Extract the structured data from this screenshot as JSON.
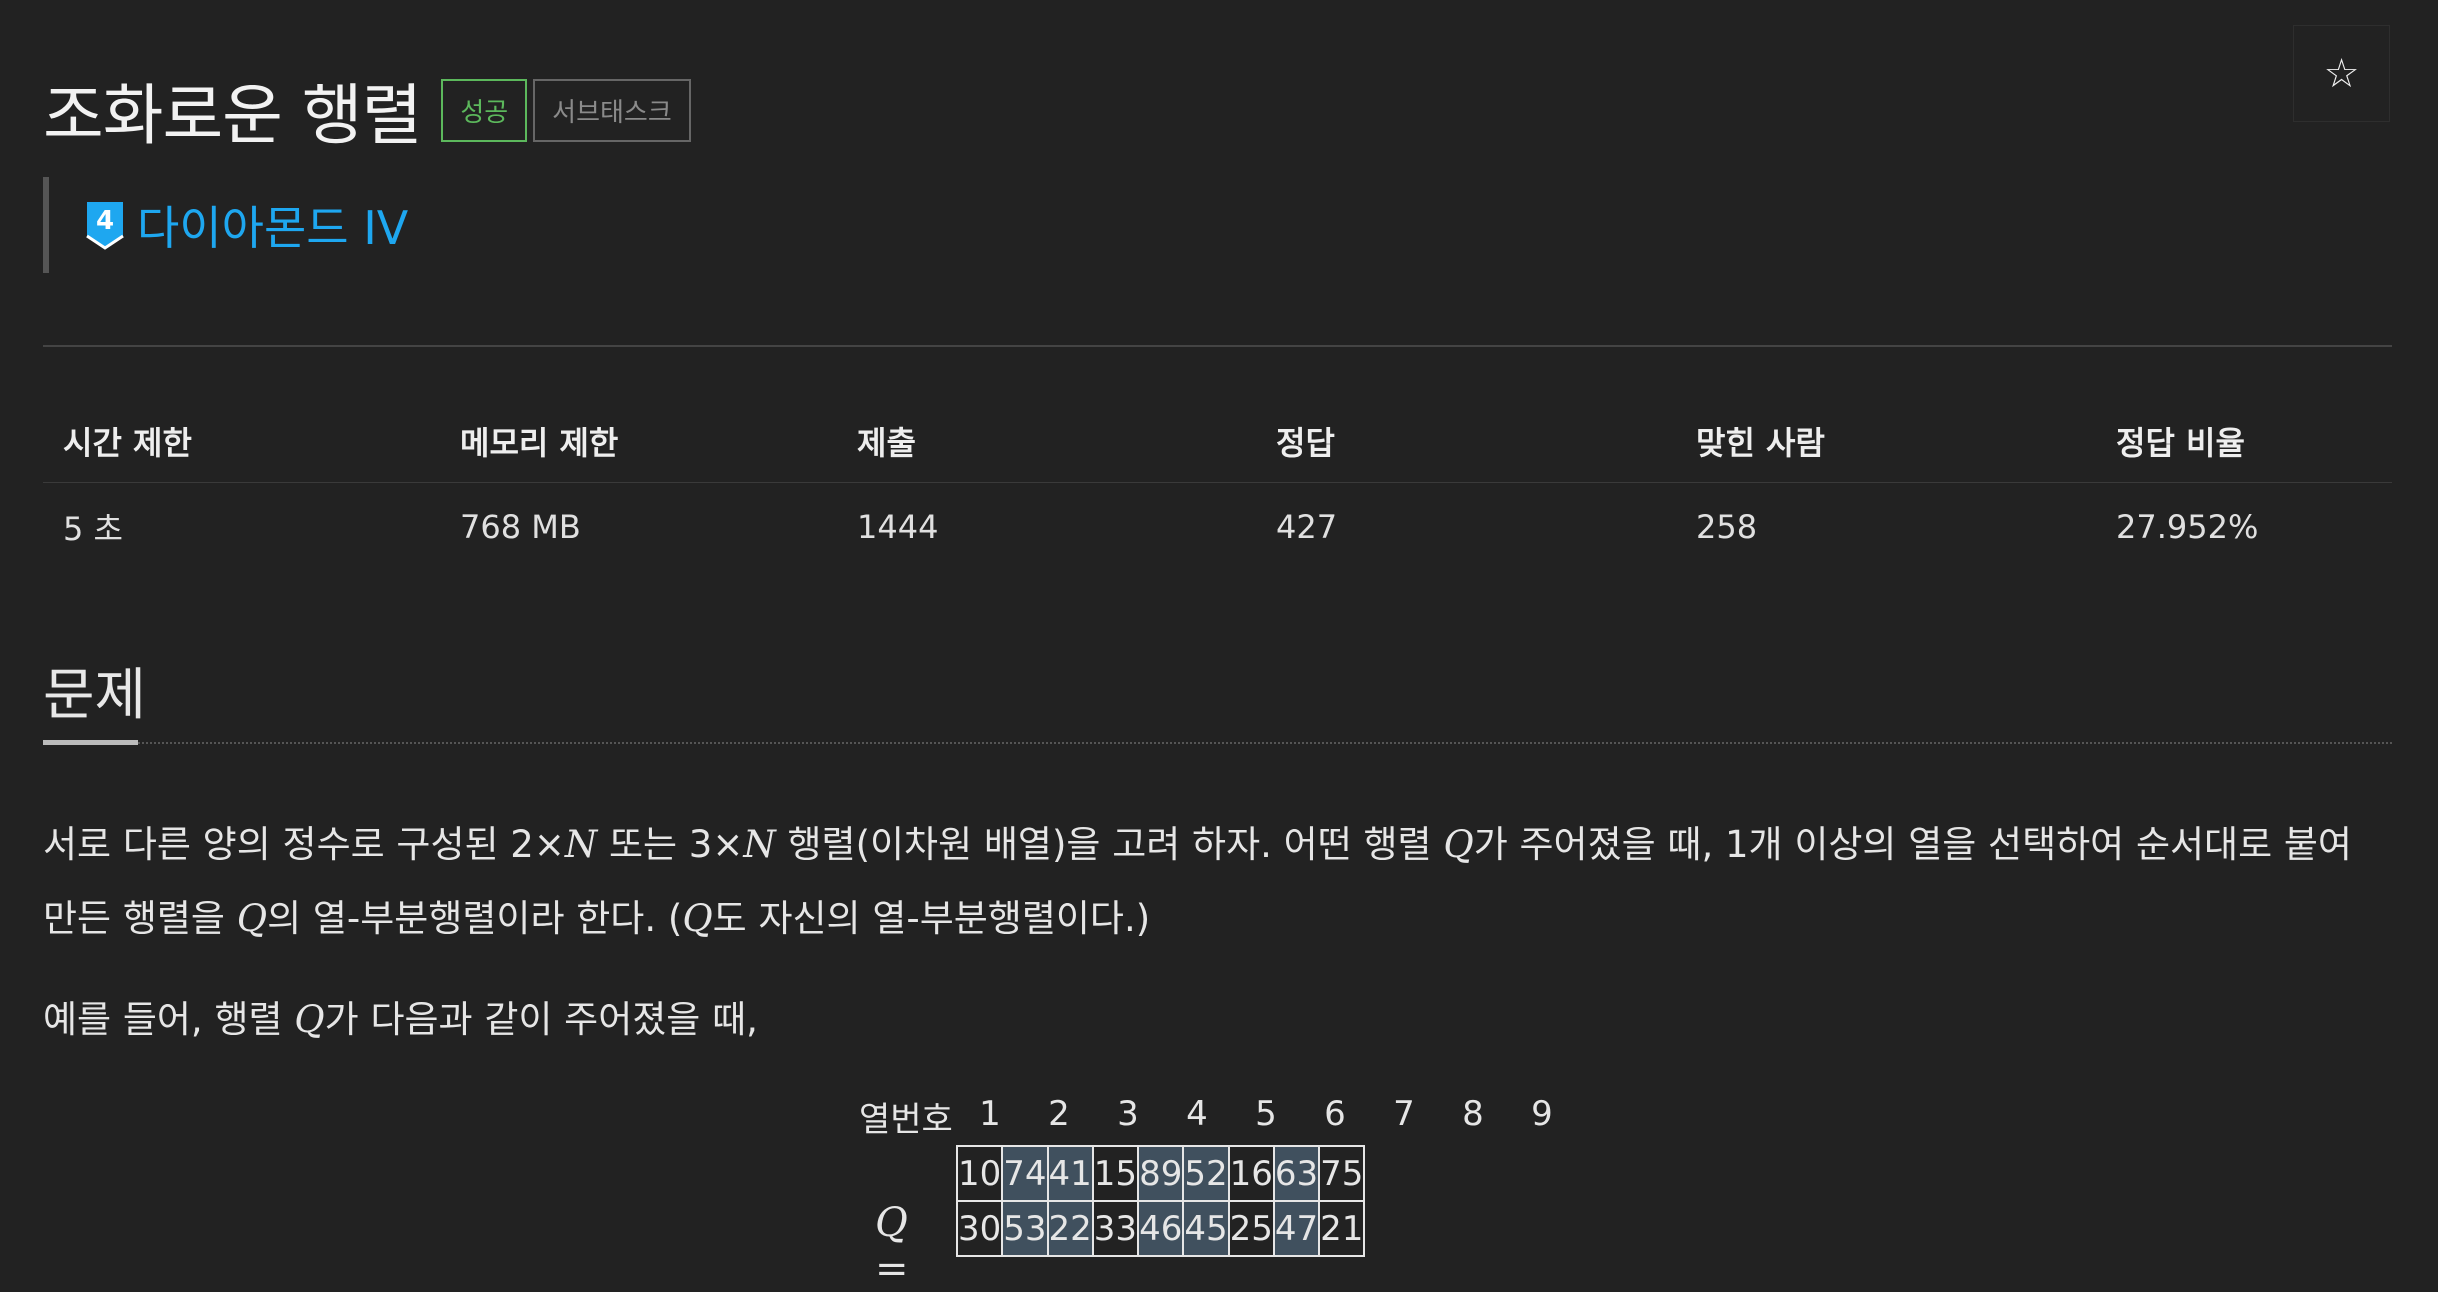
{
  "header": {
    "title": "조화로운 행렬",
    "label_success": "성공",
    "label_subtask": "서브태스크",
    "star_icon": "☆"
  },
  "tier": {
    "badge_number": "4",
    "name": "다이아몬드 IV",
    "color": "#1ea7f0"
  },
  "info": {
    "headers": [
      "시간 제한",
      "메모리 제한",
      "제출",
      "정답",
      "맞힌 사람",
      "정답 비율"
    ],
    "values": [
      "5 초",
      "768 MB",
      "1444",
      "427",
      "258",
      "27.952%"
    ]
  },
  "problem": {
    "section_title": "문제",
    "p1_a": "서로 다른 양의 정수로 구성된 2×",
    "p1_n1": "N",
    "p1_b": " 또는 3×",
    "p1_n2": "N",
    "p1_c": " 행렬(이차원 배열)을 고려 하자. 어떤 행렬 ",
    "p1_q1": "Q",
    "p1_d": "가 주어졌을 때, 1개 이상의 열을 선택하여 순서대로 붙여 만든 행렬을 ",
    "p1_q2": "Q",
    "p1_e": "의 열-부분행렬이라 한다. (",
    "p1_q3": "Q",
    "p1_f": "도 자신의 열-부분행렬이다.)",
    "p2_a": "예를 들어, 행렬 ",
    "p2_q": "Q",
    "p2_b": "가 다음과 같이 주어졌을 때,"
  },
  "matrix": {
    "column_header": "열번호",
    "column_numbers": [
      "1",
      "2",
      "3",
      "4",
      "5",
      "6",
      "7",
      "8",
      "9"
    ],
    "q_label": "Q =",
    "rows": [
      [
        "10",
        "74",
        "41",
        "15",
        "89",
        "52",
        "16",
        "63",
        "75"
      ],
      [
        "30",
        "53",
        "22",
        "33",
        "46",
        "45",
        "25",
        "47",
        "21"
      ]
    ],
    "highlighted_columns": [
      "2",
      "3",
      "5",
      "6",
      "8"
    ],
    "highlight_color": "#40505e"
  }
}
